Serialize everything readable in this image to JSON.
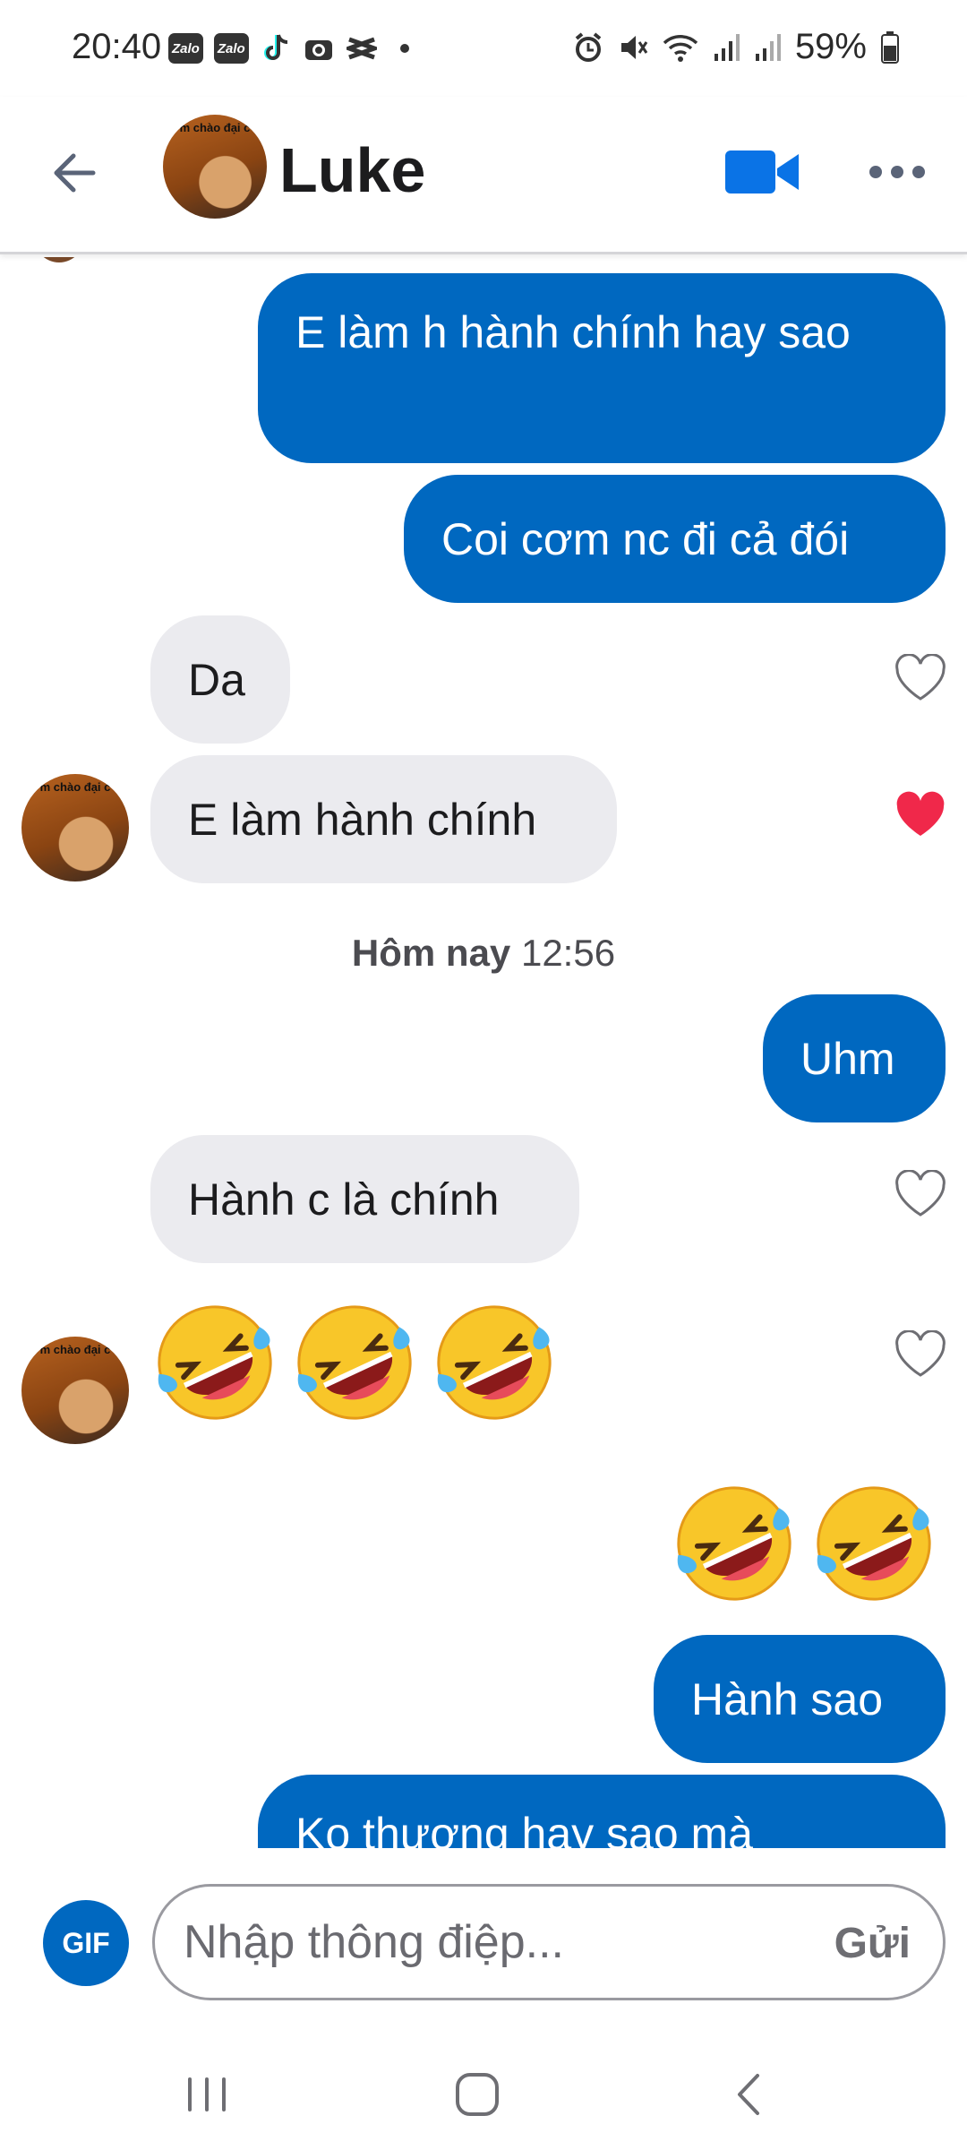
{
  "status_bar": {
    "time": "20:40",
    "app_badges": [
      "Zalo",
      "Zalo"
    ],
    "battery": "59%"
  },
  "header": {
    "contact_name": "Luke",
    "avatar_caption": "m chào đại c"
  },
  "messages": [
    {
      "direction": "out",
      "text": "E làm h hành chính hay sao"
    },
    {
      "direction": "out",
      "text": "Coi cơm nc đi cả đói"
    },
    {
      "direction": "in",
      "text": "Da",
      "liked": false
    },
    {
      "direction": "in",
      "text": "E làm hành chính",
      "liked": true
    },
    {
      "direction": "out",
      "text": "Uhm"
    },
    {
      "direction": "in",
      "text": "Hành c là chính",
      "liked": false
    },
    {
      "direction": "in",
      "emoji": "rolling-on-floor-laughing",
      "count": 3,
      "liked": false
    },
    {
      "direction": "out",
      "emoji": "rolling-on-floor-laughing",
      "count": 2
    },
    {
      "direction": "out",
      "text": "Hành sao"
    },
    {
      "direction": "out",
      "text": "Ko thương hay sao mà"
    }
  ],
  "time_separator": {
    "day": "Hôm nay",
    "time": "12:56"
  },
  "composer": {
    "gif_label": "GIF",
    "placeholder": "Nhập thông điệp...",
    "send_label": "Gửi"
  },
  "colors": {
    "outgoing_bubble": "#0068c0",
    "incoming_bubble": "#ebebef",
    "liked_heart": "#f0284a",
    "video_icon": "#0a73e6"
  }
}
